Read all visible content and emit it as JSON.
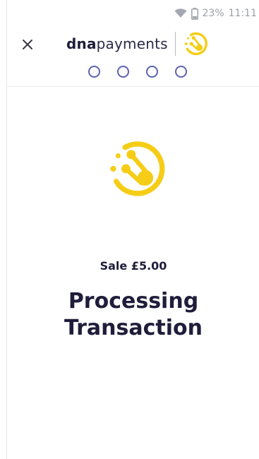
{
  "status_bar": {
    "battery_percent": "23%",
    "time": "11:11",
    "icons": [
      "wifi-icon",
      "battery-icon"
    ]
  },
  "header": {
    "close_icon": "close-icon",
    "brand": {
      "bold": "dna",
      "light": "payments",
      "logo_icon": "dna-logo-icon"
    },
    "progress_steps": 4
  },
  "main": {
    "logo_icon": "dna-logo-icon",
    "sale_label": "Sale",
    "sale_amount": "£5.00",
    "title_line1": "Processing",
    "title_line2": "Transaction"
  },
  "colors": {
    "brand_yellow": "#F6CD16",
    "step_ring": "#5C63B0",
    "text_dark": "#1F1D3A",
    "status_gray": "#9AA0A8"
  }
}
